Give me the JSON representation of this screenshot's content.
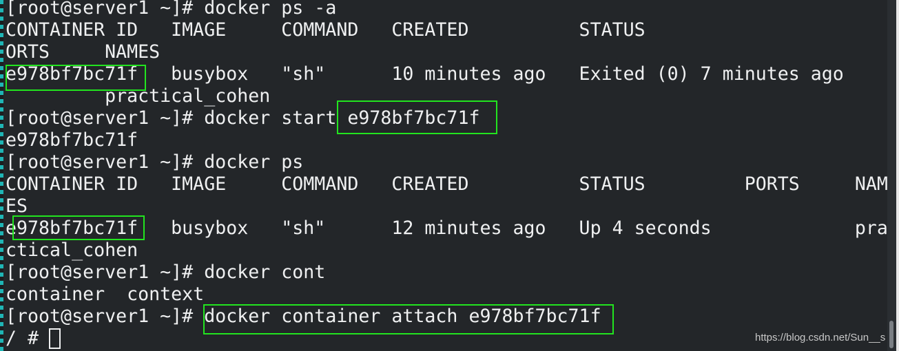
{
  "terminal": {
    "lines": [
      "[root@server1 ~]# docker ps -a",
      "CONTAINER ID   IMAGE     COMMAND   CREATED          STATUS                      P",
      "ORTS     NAMES",
      "e978bf7bc71f   busybox   \"sh\"      10 minutes ago   Exited (0) 7 minutes ago",
      "         practical_cohen",
      "[root@server1 ~]# docker start e978bf7bc71f",
      "e978bf7bc71f",
      "[root@server1 ~]# docker ps",
      "CONTAINER ID   IMAGE     COMMAND   CREATED          STATUS         PORTS     NAM",
      "ES",
      "e978bf7bc71f   busybox   \"sh\"      12 minutes ago   Up 4 seconds             pra",
      "ctical_cohen",
      "[root@server1 ~]# docker cont",
      "container  context",
      "[root@server1 ~]# docker container attach e978bf7bc71f",
      "/ # "
    ]
  },
  "watermark": "https://blog.csdn.net/Sun__s",
  "colors": {
    "background": "#232629",
    "text": "#eff0f1",
    "highlight": "#22e51f"
  }
}
